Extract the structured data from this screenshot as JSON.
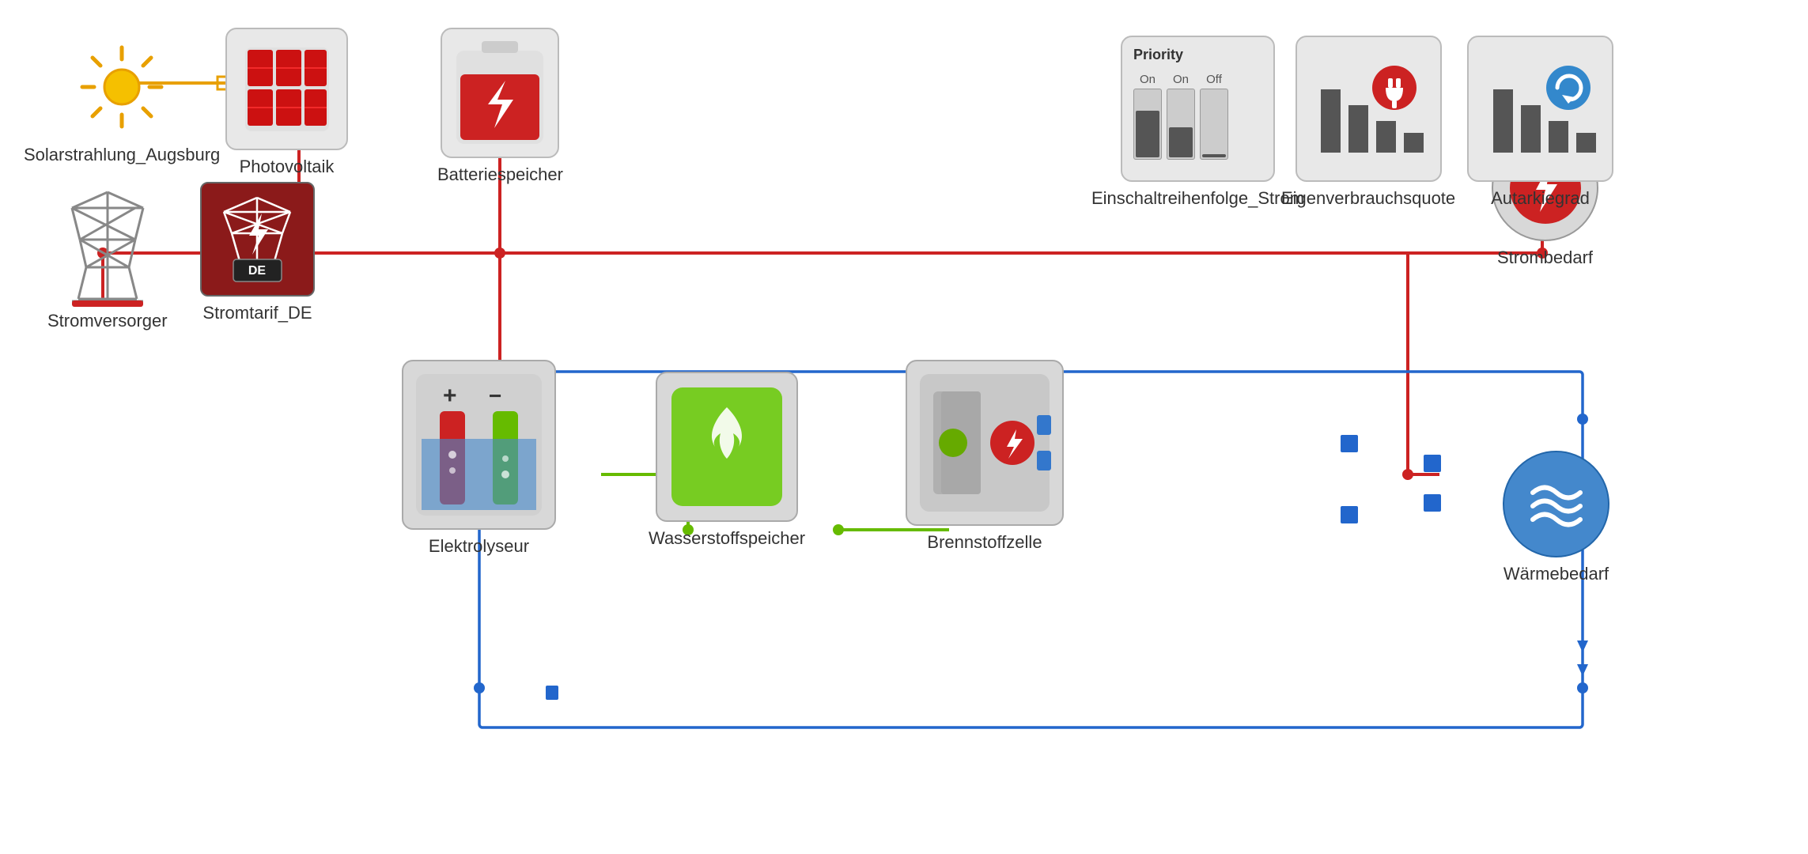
{
  "nodes": {
    "solarstrahlung": {
      "label": "Solarstrahlung_Augsburg"
    },
    "photovoltaik": {
      "label": "Photovoltaik"
    },
    "batteriespeicher": {
      "label": "Batteriespeicher"
    },
    "stromversorger": {
      "label": "Stromversorger"
    },
    "stromtarif": {
      "label": "Stromtarif_DE"
    },
    "elektrolyseur": {
      "label": "Elektrolyseur"
    },
    "wasserstoffspeicher": {
      "label": "Wasserstoffspeicher"
    },
    "brennstoffzelle": {
      "label": "Brennstoffzelle"
    },
    "strombedarf": {
      "label": "Strombedarf"
    },
    "waermebedarf": {
      "label": "Wärmebedarf"
    },
    "einschaltreihenfolge": {
      "label": "Einschaltreihenfolge_Strom"
    },
    "eigenverbrauchsquote": {
      "label": "Eigenverbrauchsquote"
    },
    "autarkiegrad": {
      "label": "Autarkiegrad"
    }
  },
  "priority": {
    "title": "Priority",
    "options": [
      "On",
      "On",
      "Off"
    ]
  },
  "colors": {
    "red": "#cc2222",
    "yellow": "#e8a000",
    "blue": "#2266cc",
    "green": "#66bb00",
    "gray": "#888888"
  }
}
